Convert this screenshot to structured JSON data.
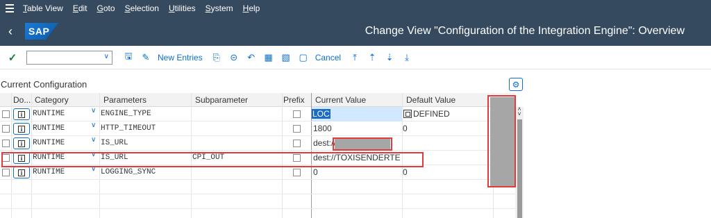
{
  "menu": {
    "items": [
      {
        "under": "T",
        "rest": "able View"
      },
      {
        "under": "E",
        "rest": "dit"
      },
      {
        "under": "G",
        "rest": "oto"
      },
      {
        "under": "S",
        "rest": "election"
      },
      {
        "under": "U",
        "rest": "tilities"
      },
      {
        "under": "S",
        "rest": "ystem"
      },
      {
        "under": "H",
        "rest": "elp"
      }
    ]
  },
  "header": {
    "logo": "SAP",
    "title": "Change View \"Configuration of the Integration Engine\": Overview"
  },
  "toolbar": {
    "command_value": "",
    "new_entries": "New Entries",
    "cancel": "Cancel"
  },
  "section": {
    "title": "Current Configuration"
  },
  "table": {
    "columns": [
      "Do...",
      "Category",
      "Parameters",
      "Subparameter",
      "Prefix",
      "Current Value",
      "Default Value"
    ],
    "rows": [
      {
        "category": "RUNTIME",
        "parameter": "ENGINE_TYPE",
        "subparameter": "",
        "current": "LOC",
        "default": "DEFINED",
        "selected": true
      },
      {
        "category": "RUNTIME",
        "parameter": "HTTP_TIMEOUT",
        "subparameter": "",
        "current": "1800",
        "default": "0"
      },
      {
        "category": "RUNTIME",
        "parameter": "IS_URL",
        "subparameter": "",
        "current": "dest://",
        "default": ""
      },
      {
        "category": "RUNTIME",
        "parameter": "IS_URL",
        "subparameter": "CPI_OUT",
        "current": "dest://TOXISENDERTENA...",
        "default": ""
      },
      {
        "category": "RUNTIME",
        "parameter": "LOGGING_SYNC",
        "subparameter": "",
        "current": "0",
        "default": "0"
      }
    ]
  },
  "colors": {
    "shell": "#354a5f",
    "accent": "#0a6ed1",
    "highlight": "#e03a3a",
    "redaction": "#a6a6a6"
  }
}
